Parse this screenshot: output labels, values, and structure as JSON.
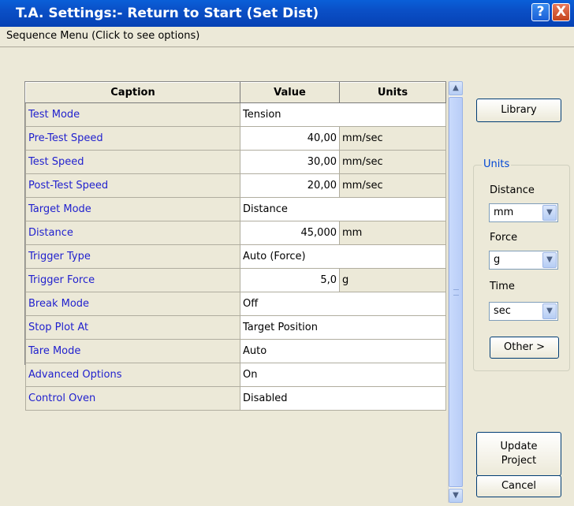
{
  "window": {
    "title": "T.A. Settings:- Return to Start (Set Dist)",
    "help_glyph": "?",
    "close_glyph": "X"
  },
  "menu": {
    "label": "Sequence Menu (Click to see options)"
  },
  "grid": {
    "headers": {
      "caption": "Caption",
      "value": "Value",
      "units": "Units"
    },
    "rows": [
      {
        "caption": "Test Mode",
        "value": "Tension",
        "units": ""
      },
      {
        "caption": "Pre-Test Speed",
        "value": "40,00",
        "units": "mm/sec"
      },
      {
        "caption": "Test Speed",
        "value": "30,00",
        "units": "mm/sec"
      },
      {
        "caption": "Post-Test Speed",
        "value": "20,00",
        "units": "mm/sec"
      },
      {
        "caption": "Target Mode",
        "value": "Distance",
        "units": ""
      },
      {
        "caption": "Distance",
        "value": "45,000",
        "units": "mm"
      },
      {
        "caption": "Trigger Type",
        "value": "Auto (Force)",
        "units": ""
      },
      {
        "caption": "Trigger Force",
        "value": "5,0",
        "units": "g"
      },
      {
        "caption": "Break Mode",
        "value": "Off",
        "units": ""
      },
      {
        "caption": "Stop Plot At",
        "value": "Target Position",
        "units": ""
      },
      {
        "caption": "Tare Mode",
        "value": "Auto",
        "units": ""
      },
      {
        "caption": "Advanced Options",
        "value": "On",
        "units": ""
      },
      {
        "caption": "Control Oven",
        "value": "Disabled",
        "units": ""
      }
    ]
  },
  "scrollbar": {
    "up_glyph": "▲",
    "down_glyph": "▼"
  },
  "side": {
    "library_label": "Library",
    "units_group": {
      "legend": "Units",
      "distance_label": "Distance",
      "distance_value": "mm",
      "force_label": "Force",
      "force_value": "g",
      "time_label": "Time",
      "time_value": "sec",
      "other_label": "Other >"
    },
    "update_label_line1": "Update",
    "update_label_line2": "Project",
    "cancel_label": "Cancel"
  },
  "colors": {
    "title_bar": "#0a4fc6",
    "caption_text": "#1f1fce",
    "group_legend": "#0046d5",
    "window_bg": "#ece9d8"
  }
}
